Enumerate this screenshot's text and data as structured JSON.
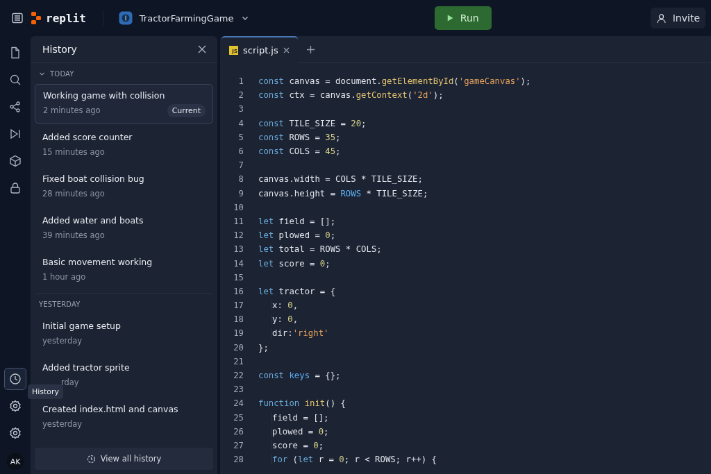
{
  "topbar": {
    "logo": "replit",
    "project": "TractorFarmingGame",
    "run": "Run",
    "invite": "Invite"
  },
  "rail": {
    "top": [
      {
        "kind": "file",
        "selected": false
      },
      {
        "kind": "search",
        "selected": false
      },
      {
        "kind": "nodes",
        "selected": false
      },
      {
        "kind": "play",
        "selected": false
      },
      {
        "kind": "cube",
        "selected": false
      },
      {
        "kind": "lock",
        "selected": false
      }
    ],
    "bottom": [
      {
        "kind": "history",
        "selected": true
      },
      {
        "kind": "gear",
        "selected": false
      },
      {
        "kind": "gear",
        "selected": false
      }
    ],
    "avatar": "AK",
    "tooltip": "History"
  },
  "history": {
    "title": "History",
    "groups": [
      {
        "label": "TODAY",
        "kind": "toggle",
        "entries": [
          {
            "title": "Working game with collision",
            "time": "2 minutes ago",
            "selected": true,
            "covered": false,
            "badge": "Current"
          },
          {
            "title": "Added score counter",
            "time": "15 minutes ago",
            "selected": false,
            "covered": false
          },
          {
            "title": "Fixed boat collision bug",
            "time": "28 minutes ago",
            "selected": false,
            "covered": false
          },
          {
            "title": "Added water and boats",
            "time": "39 minutes ago",
            "selected": false,
            "covered": false
          },
          {
            "title": "Basic movement working",
            "time": "1 hour ago",
            "selected": false,
            "covered": false
          }
        ]
      },
      {
        "label": "YESTERDAY",
        "kind": "plain",
        "entries": [
          {
            "title": "Initial game setup",
            "time": "yesterday",
            "selected": false,
            "covered": false
          },
          {
            "title": "Added tractor sprite",
            "time": "rday",
            "selected": false,
            "covered": true
          },
          {
            "title": "Created index.html and canvas",
            "time": "yesterday",
            "selected": false,
            "covered": false
          }
        ]
      }
    ],
    "view_all": "View all history"
  },
  "editor": {
    "tabs": [
      {
        "label": "script.js",
        "badge": "JS",
        "selected": true
      }
    ],
    "lines": [
      {
        "number": "1",
        "kind": "plain",
        "tokens": [
          {
            "kind": "kw",
            "text": "const"
          },
          {
            "kind": "plain",
            "text": " canvas = document."
          },
          {
            "kind": "fn",
            "text": "getElementById"
          },
          {
            "kind": "plain",
            "text": "("
          },
          {
            "kind": "str",
            "text": "'gameCanvas'"
          },
          {
            "kind": "plain",
            "text": ");"
          }
        ]
      },
      {
        "number": "2",
        "kind": "plain",
        "tokens": [
          {
            "kind": "kw",
            "text": "const"
          },
          {
            "kind": "plain",
            "text": " ctx = canvas."
          },
          {
            "kind": "fn",
            "text": "getContext"
          },
          {
            "kind": "plain",
            "text": "("
          },
          {
            "kind": "str",
            "text": "'2d'"
          },
          {
            "kind": "plain",
            "text": ");"
          }
        ]
      },
      {
        "number": "3"
      },
      {
        "number": "4",
        "kind": "plain",
        "tokens": [
          {
            "kind": "kw",
            "text": "const"
          },
          {
            "kind": "plain",
            "text": " TILE_SIZE = "
          },
          {
            "kind": "num",
            "text": "20"
          },
          {
            "kind": "plain",
            "text": ";"
          }
        ]
      },
      {
        "number": "5",
        "kind": "plain",
        "tokens": [
          {
            "kind": "kw",
            "text": "const"
          },
          {
            "kind": "plain",
            "text": " ROWS = "
          },
          {
            "kind": "num",
            "text": "35"
          },
          {
            "kind": "plain",
            "text": ";"
          }
        ]
      },
      {
        "number": "6",
        "kind": "plain",
        "tokens": [
          {
            "kind": "kw",
            "text": "const"
          },
          {
            "kind": "plain",
            "text": " COLS = "
          },
          {
            "kind": "num",
            "text": "45"
          },
          {
            "kind": "plain",
            "text": ";"
          }
        ]
      },
      {
        "number": "7"
      },
      {
        "number": "8",
        "kind": "plain",
        "tokens": [
          {
            "kind": "plain",
            "text": "canvas.width = COLS * TILE_SIZE;"
          }
        ]
      },
      {
        "number": "9",
        "kind": "plain",
        "tokens": [
          {
            "kind": "plain",
            "text": "canvas.height = "
          },
          {
            "kind": "var",
            "text": "ROWS"
          },
          {
            "kind": "plain",
            "text": " * TILE_SIZE;"
          }
        ]
      },
      {
        "number": "10"
      },
      {
        "number": "11",
        "kind": "plain",
        "tokens": [
          {
            "kind": "kw",
            "text": "let"
          },
          {
            "kind": "plain",
            "text": " field = [];"
          }
        ]
      },
      {
        "number": "12",
        "kind": "plain",
        "tokens": [
          {
            "kind": "kw",
            "text": "let"
          },
          {
            "kind": "plain",
            "text": " plowed = "
          },
          {
            "kind": "num",
            "text": "0"
          },
          {
            "kind": "plain",
            "text": ";"
          }
        ]
      },
      {
        "number": "13",
        "kind": "plain",
        "tokens": [
          {
            "kind": "kw",
            "text": "let"
          },
          {
            "kind": "plain",
            "text": " total = ROWS * COLS;"
          }
        ]
      },
      {
        "number": "14",
        "kind": "plain",
        "tokens": [
          {
            "kind": "kw",
            "text": "let"
          },
          {
            "kind": "plain",
            "text": " score = "
          },
          {
            "kind": "num",
            "text": "0"
          },
          {
            "kind": "plain",
            "text": ";"
          }
        ]
      },
      {
        "number": "15"
      },
      {
        "number": "16",
        "kind": "plain",
        "tokens": [
          {
            "kind": "kw",
            "text": "let"
          },
          {
            "kind": "plain",
            "text": " tractor = {"
          }
        ]
      },
      {
        "number": "17",
        "kind": "indented",
        "tokens": [
          {
            "kind": "plain",
            "text": "x: "
          },
          {
            "kind": "num",
            "text": "0"
          },
          {
            "kind": "plain",
            "text": ","
          }
        ]
      },
      {
        "number": "18",
        "kind": "indented",
        "tokens": [
          {
            "kind": "plain",
            "text": "y: "
          },
          {
            "kind": "num",
            "text": "0"
          },
          {
            "kind": "plain",
            "text": ","
          }
        ]
      },
      {
        "number": "19",
        "kind": "indented",
        "tokens": [
          {
            "kind": "plain",
            "text": "dir:"
          },
          {
            "kind": "str",
            "text": "'right'"
          }
        ]
      },
      {
        "number": "20",
        "kind": "plain",
        "tokens": [
          {
            "kind": "plain",
            "text": "};"
          }
        ]
      },
      {
        "number": "21"
      },
      {
        "number": "22",
        "kind": "plain",
        "tokens": [
          {
            "kind": "kw",
            "text": "const"
          },
          {
            "kind": "var",
            "text": " keys"
          },
          {
            "kind": "plain",
            "text": " = {};"
          }
        ]
      },
      {
        "number": "23"
      },
      {
        "number": "24",
        "kind": "plain",
        "tokens": [
          {
            "kind": "kw",
            "text": "function"
          },
          {
            "kind": "fn",
            "text": " init"
          },
          {
            "kind": "plain",
            "text": "() {"
          }
        ]
      },
      {
        "number": "25",
        "kind": "indented",
        "tokens": [
          {
            "kind": "plain",
            "text": "field = [];"
          }
        ]
      },
      {
        "number": "26",
        "kind": "indented",
        "tokens": [
          {
            "kind": "plain",
            "text": "plowed = "
          },
          {
            "kind": "num",
            "text": "0"
          },
          {
            "kind": "plain",
            "text": ";"
          }
        ]
      },
      {
        "number": "27",
        "kind": "indented",
        "tokens": [
          {
            "kind": "plain",
            "text": "score = "
          },
          {
            "kind": "num",
            "text": "0"
          },
          {
            "kind": "plain",
            "text": ";"
          }
        ]
      },
      {
        "number": "28",
        "kind": "indented",
        "tokens": [
          {
            "kind": "kw",
            "text": "for"
          },
          {
            "kind": "plain",
            "text": " ("
          },
          {
            "kind": "kw",
            "text": "let"
          },
          {
            "kind": "plain",
            "text": " r = "
          },
          {
            "kind": "num",
            "text": "0"
          },
          {
            "kind": "plain",
            "text": "; r < ROWS; r++) {"
          }
        ]
      }
    ]
  }
}
